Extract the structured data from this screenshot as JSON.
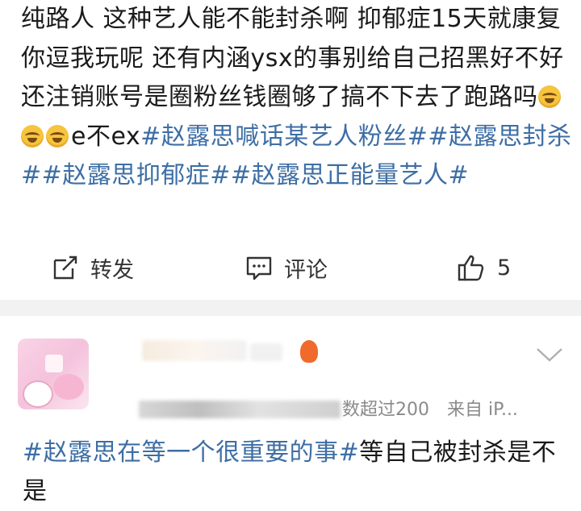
{
  "post": {
    "text_before": "纯路人 这种艺人能不能封杀啊 抑郁症15天就康复你逗我玩呢 还有内涵ysx的事别给自己招黑好不好 还注销账号是圈粉丝钱圈够了搞不下去了跑路吗",
    "emoji_name": "laugh-cry-emoji",
    "text_after_emoji": "e不ex",
    "hashtags": [
      "#赵露思喊话某艺人粉丝#",
      "#赵露思封杀#",
      "#赵露思抑郁症#",
      "#赵露思正能量艺人#"
    ]
  },
  "actions": {
    "repost_label": "转发",
    "comment_label": "评论",
    "like_count": "5"
  },
  "comment": {
    "meta_visible": "数超过200",
    "source": "来自 iP...",
    "hashtag": "#赵露思在等一个很重要的事#",
    "text": "等自己被封杀是不是"
  },
  "colors": {
    "hashtag": "#3d6ea5",
    "divider": "#f2f2f2",
    "meta": "#8a8a8a"
  }
}
